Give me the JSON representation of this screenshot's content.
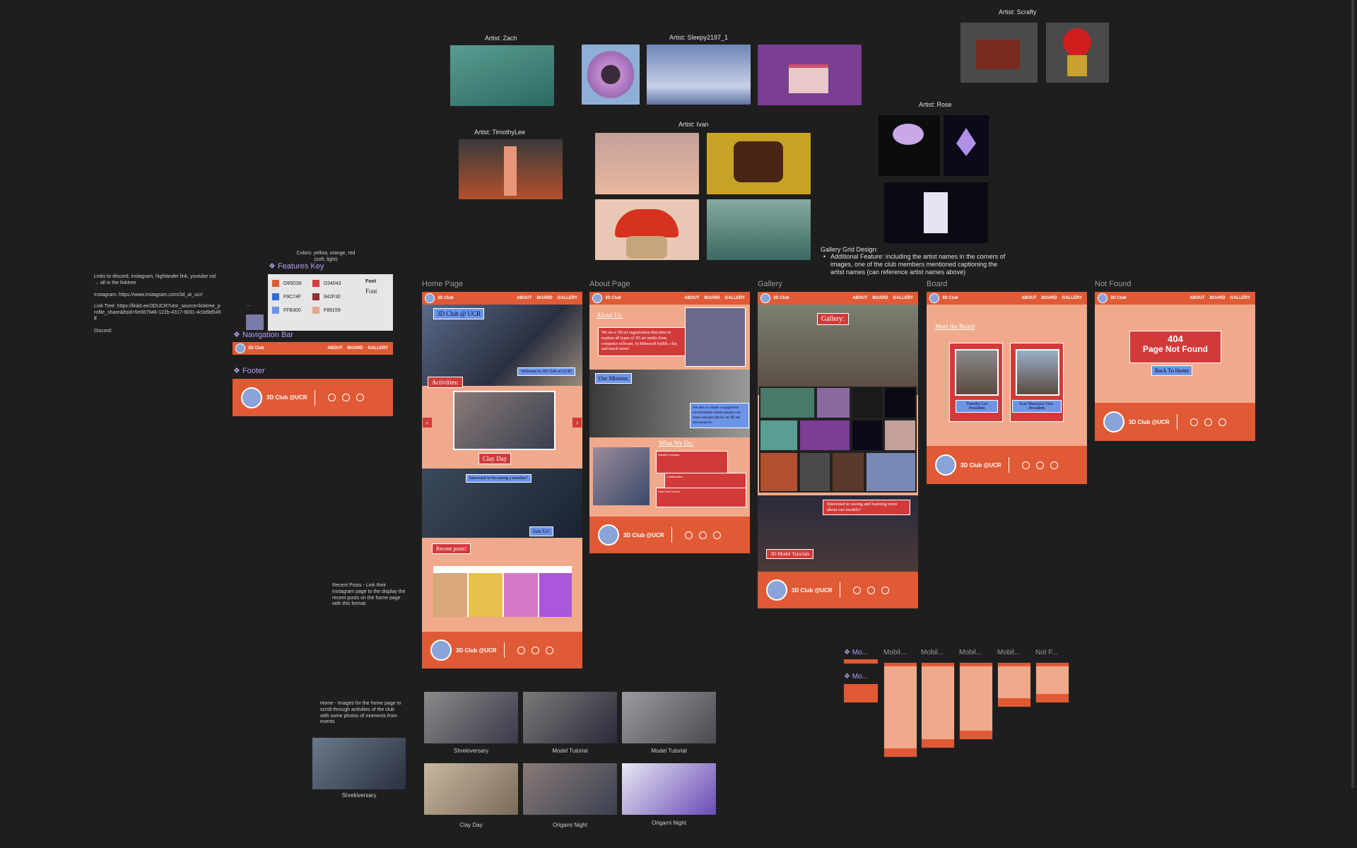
{
  "artists": {
    "zach": "Artist: Zach",
    "sleepy": "Artist: Sleepy2197_1",
    "scrafty": "Artist: Scrafty",
    "timothy": "Artist: TimothyLee",
    "ivan": "Artist: Ivan",
    "rose": "Artist: Rose"
  },
  "notes": {
    "links": "Links to discord, instagram, highlander link, youtube vid → all in the linktree",
    "instagram": "Instagram: https://www.instagram.com/3d_at_ucr/",
    "linktree": "Link Tree: https://linktr.ee/3DUCR?utm_source=linktree_profile_share&ltsid=5e067946-122b-4317-9031-4c0d9d545ff",
    "discord": "Discord:",
    "colors": "Colors: yellow, orange, red (soft, light)",
    "gallery_title": "Gallery Grid Design:",
    "gallery_bullet": "Additional Feature: including the artist names in the corners of images, one of the club members mentioned captioning the artist names (can reference artist names above)",
    "recent": "Recent Posts - Link their Instagram page to the display the recent posts on the home page with this format.",
    "home_images": "Home - Images for the home page to scroll through activities of the club with some photos of moments from events",
    "ellipsis": "..."
  },
  "components": {
    "features_key": "Features Key",
    "nav_bar": "Navigation Bar",
    "footer": "Footer",
    "swatches": [
      {
        "hex": "D95D39",
        "color": "#D95D39"
      },
      {
        "hex": "D34043",
        "color": "#D34043"
      },
      {
        "hex": "F9C74F",
        "color": "#F9C74F"
      },
      {
        "hex": "942F30",
        "color": "#942F30"
      },
      {
        "hex": "FFB300",
        "color": "#FFB300"
      },
      {
        "hex": "F89159",
        "color": "#F89159"
      }
    ],
    "font_bold": "Font",
    "font_serif": "Font"
  },
  "nav": {
    "brand": "3D Club",
    "about": "ABOUT",
    "board": "BOARD",
    "gallery": "GALLERY"
  },
  "footer": {
    "name": "3D Club @UCR"
  },
  "frames": {
    "home": "Home Page",
    "about": "About Page",
    "gallery": "Gallery",
    "board": "Board",
    "notfound": "Not Found"
  },
  "home": {
    "hero": "3D Club @ UCR",
    "welcome": "Welcome to 3D Club at UCR!",
    "activities": "Activities:",
    "clay": "Clay Day",
    "interested": "Interested in becoming a member?",
    "join": "Join Us!",
    "recent": "Recent posts!"
  },
  "about": {
    "about_us": "About Us:",
    "about_text": "We are a 3D art organization that aims to explore all types of 3D art media from computer software, to Minecraft builds, clay, and much more!",
    "mission": "Our Mission:",
    "mission_text": "We aim to create a supportive environment where people can share and get advice on 3D art and projects.",
    "what": "What We Do:",
    "what1": "Weekly meetings",
    "what2": "Collaborative",
    "what3": "Past Club Events"
  },
  "gallery": {
    "title": "Gallery:",
    "interest": "Interested in seeing and learning more about our models?",
    "tutorials": "3D Model Tutorials"
  },
  "board": {
    "title": "Meet the Board",
    "m1": "Timothy Lee President",
    "m2": "Ivan Marcuzzi Vice-President"
  },
  "notfound": {
    "code": "404",
    "msg": "Page Not Found",
    "back": "Back To Home"
  },
  "photos": {
    "left": "Shrekiversary",
    "p1": "Shrekiversary",
    "p2": "Model Tutorial",
    "p3": "Model Tutorial",
    "p4": "Clay Day",
    "p5": "Origami Night",
    "p6": "Origami Night"
  },
  "mobile": {
    "m1": "Mo...",
    "m2": "Mobil...",
    "m3": "Mobil...",
    "m4": "Mobil...",
    "m5": "Mobil...",
    "m6": "Not F...",
    "c1": "Mo..."
  }
}
